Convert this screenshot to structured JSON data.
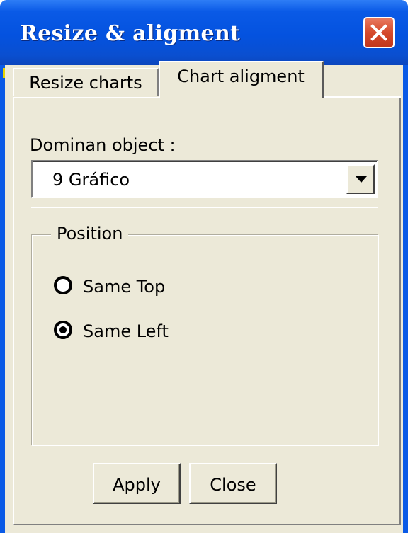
{
  "window": {
    "title": "Resize & aligment",
    "close_icon": "close-icon"
  },
  "tabs": [
    {
      "label": "Resize charts",
      "active": false
    },
    {
      "label": "Chart aligment",
      "active": true
    }
  ],
  "dominant": {
    "label": "Dominan object :",
    "value": "9 Gráfico"
  },
  "position_group": {
    "legend": "Position",
    "options": [
      {
        "label": "Same Top",
        "selected": false
      },
      {
        "label": "Same Left",
        "selected": true
      }
    ]
  },
  "buttons": {
    "apply": "Apply",
    "close": "Close"
  },
  "colors": {
    "titlebar": "#0a5ae6",
    "dialog_bg": "#ece9d8",
    "close_button": "#d54a2c"
  }
}
